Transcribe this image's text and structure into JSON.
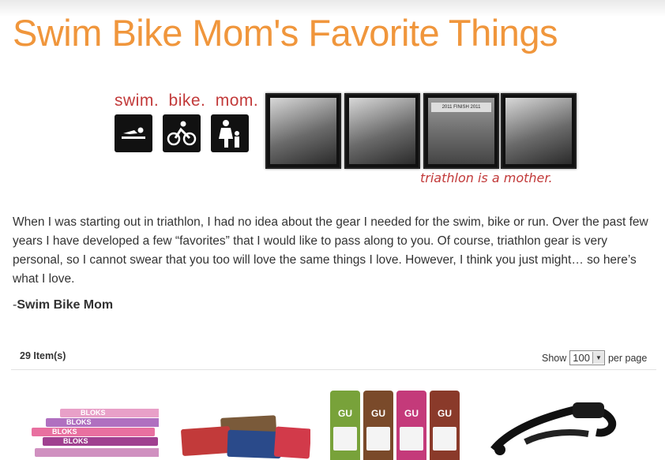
{
  "page": {
    "title": "Swim Bike Mom's Favorite Things"
  },
  "banner": {
    "brand_words": [
      "swim.",
      "bike.",
      "mom."
    ],
    "tagline": "triathlon is a mother.",
    "icons": [
      "swimmer-icon",
      "cyclist-icon",
      "mother-child-icon"
    ],
    "photo_text": {
      "finish": "FINISH",
      "year_left": "2011",
      "year_right": "2011"
    }
  },
  "intro": {
    "paragraph": "When I was starting out in triathlon, I had no idea about the gear I needed for the swim, bike or run.  Over the past few years I have developed a few “favorites” that I would like to pass along to you. Of course, triathlon gear is very personal, so I cannot swear that you too will love the same things I love. However, I think you just might… so here’s what I love.",
    "signature_dash": "-",
    "signature_name": "Swim Bike Mom"
  },
  "listing": {
    "item_count": "29 Item(s)",
    "show_label": "Show",
    "per_page_value": "100",
    "per_page_label": "per page"
  },
  "products": {
    "bloks_text": "BLOKS",
    "gu_text": "GU",
    "colors": {
      "bloks": [
        "#e8a0c8",
        "#b070c0",
        "#e870a0",
        "#a04090"
      ],
      "gu": [
        "#78a23a",
        "#7a4a2a",
        "#c43a7a",
        "#8a3a2a"
      ]
    }
  },
  "colors": {
    "title": "#f0963c",
    "brand_red": "#c23a3a",
    "text": "#333333"
  }
}
